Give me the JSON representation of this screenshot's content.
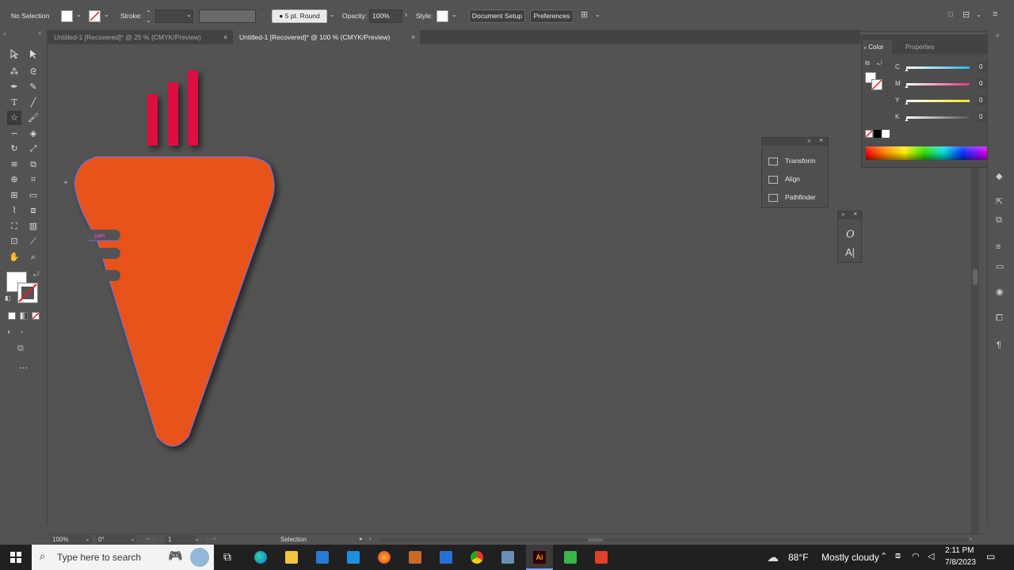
{
  "control_bar": {
    "selection_label": "No Selection",
    "stroke_label": "Stroke:",
    "stroke_profile": "5 pt. Round",
    "opacity_label": "Opacity:",
    "opacity_value": "100%",
    "style_label": "Style:",
    "document_setup_label": "Document Setup",
    "preferences_label": "Preferences"
  },
  "tabs": [
    {
      "label": "Untitled-1 [Recovered]* @ 25 % (CMYK/Preview)",
      "active": false
    },
    {
      "label": "Untitled-1 [Recovered]* @ 100 % (CMYK/Preview)",
      "active": true
    }
  ],
  "artwork": {
    "path_label": "path",
    "carrot_color": "#e8521c",
    "leaf_color": "#e0073f"
  },
  "color_panel": {
    "tabs": [
      "Color",
      "Properties"
    ],
    "channels": [
      {
        "label": "C",
        "value": "0",
        "unit": "%",
        "color": "#29b6e8"
      },
      {
        "label": "M",
        "value": "0",
        "unit": "%",
        "color": "#e6307f"
      },
      {
        "label": "Y",
        "value": "0",
        "unit": "%",
        "color": "#f3e81e"
      },
      {
        "label": "K",
        "value": "0",
        "unit": "%",
        "color": "#555555"
      }
    ]
  },
  "floating_panel": {
    "items": [
      "Transform",
      "Align",
      "Pathfinder"
    ]
  },
  "status_bar": {
    "zoom": "100%",
    "rotation": "0°",
    "artboard": "1",
    "tool": "Selection"
  },
  "taskbar": {
    "search_placeholder": "Type here to search",
    "weather_temp": "88°F",
    "weather_desc": "Mostly cloudy",
    "time": "2:11 PM",
    "date": "7/8/2023"
  }
}
